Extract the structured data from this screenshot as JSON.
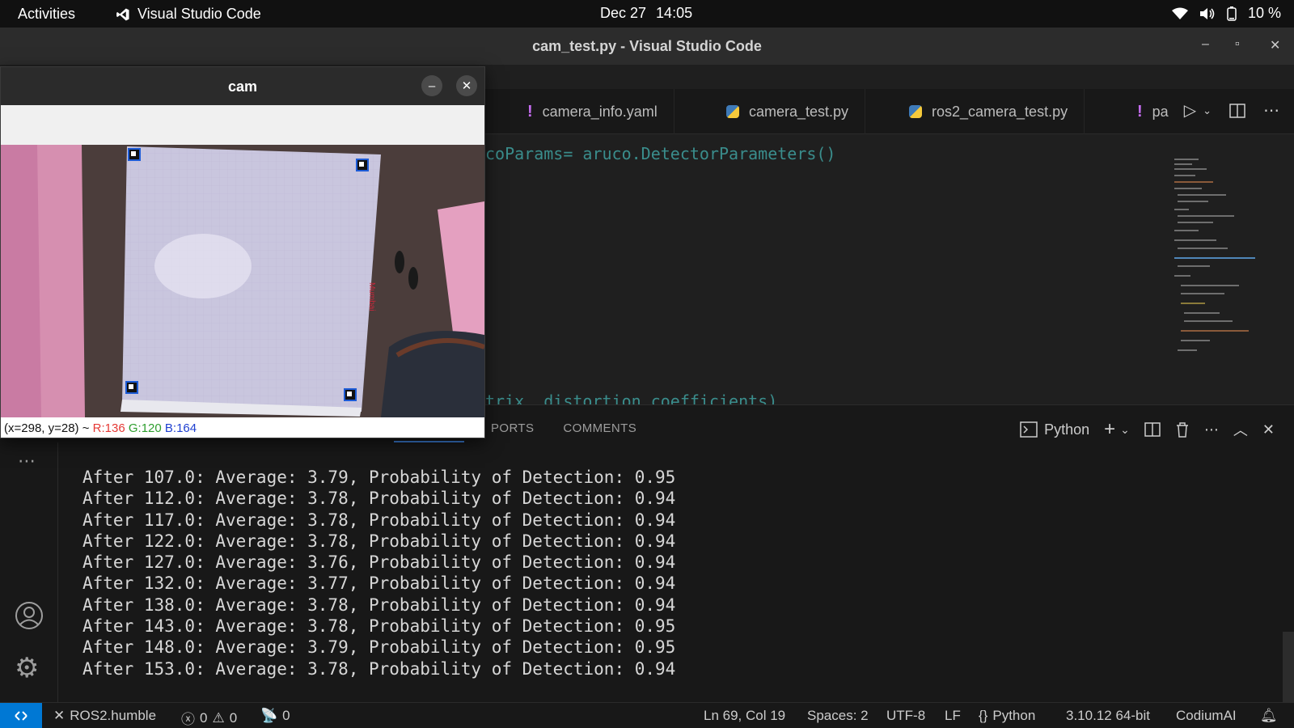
{
  "topbar": {
    "activities": "Activities",
    "app_name": "Visual Studio Code",
    "date": "Dec 27",
    "time": "14:05",
    "battery": "10 %"
  },
  "window": {
    "title": "cam_test.py - Visual Studio Code"
  },
  "tabs": [
    {
      "label": "camera_info.yaml",
      "icon": "yaml-exclamation-icon"
    },
    {
      "label": "camera_test.py",
      "icon": "python-icon"
    },
    {
      "label": "ros2_camera_test.py",
      "icon": "python-icon"
    },
    {
      "label": "pa",
      "icon": "yaml-exclamation-icon"
    }
  ],
  "editor": {
    "line_top": "coParams= aruco.DetectorParameters()",
    "line_bottom": "trix, distortion coefficients)"
  },
  "panel": {
    "tabs": [
      "PORTS",
      "COMMENTS"
    ],
    "terminal_profile": "Python",
    "terminal_lines": [
      "After 107.0: Average: 3.79, Probability of Detection: 0.95",
      "After 112.0: Average: 3.78, Probability of Detection: 0.94",
      "After 117.0: Average: 3.78, Probability of Detection: 0.94",
      "After 122.0: Average: 3.78, Probability of Detection: 0.94",
      "After 127.0: Average: 3.76, Probability of Detection: 0.94",
      "After 132.0: Average: 3.77, Probability of Detection: 0.94",
      "After 138.0: Average: 3.78, Probability of Detection: 0.94",
      "After 143.0: Average: 3.78, Probability of Detection: 0.95",
      "After 148.0: Average: 3.79, Probability of Detection: 0.95",
      "After 153.0: Average: 3.78, Probability of Detection: 0.94"
    ]
  },
  "statusbar": {
    "workspace": "ROS2.humble",
    "errors": "0",
    "warnings": "0",
    "ports": "0",
    "position": "Ln 69, Col 19",
    "spaces": "Spaces: 2",
    "encoding": "UTF-8",
    "eol": "LF",
    "language": "Python",
    "interpreter": "3.10.12 64-bit",
    "extension": "CodiumAI"
  },
  "cam_window": {
    "title": "cam",
    "status_coords": "(x=298, y=28) ~",
    "status_r": "R:136",
    "status_g": "G:120",
    "status_b": "B:164",
    "board_label": "Mumbai"
  },
  "colors": {
    "accent": "#0078d4",
    "editor_bg": "#1f1f1f",
    "tab_bar_bg": "#181818",
    "yaml_bang": "#c56cf0",
    "status_r": "#e53935",
    "status_g": "#2e9e2e",
    "status_b": "#1e3fd0"
  }
}
